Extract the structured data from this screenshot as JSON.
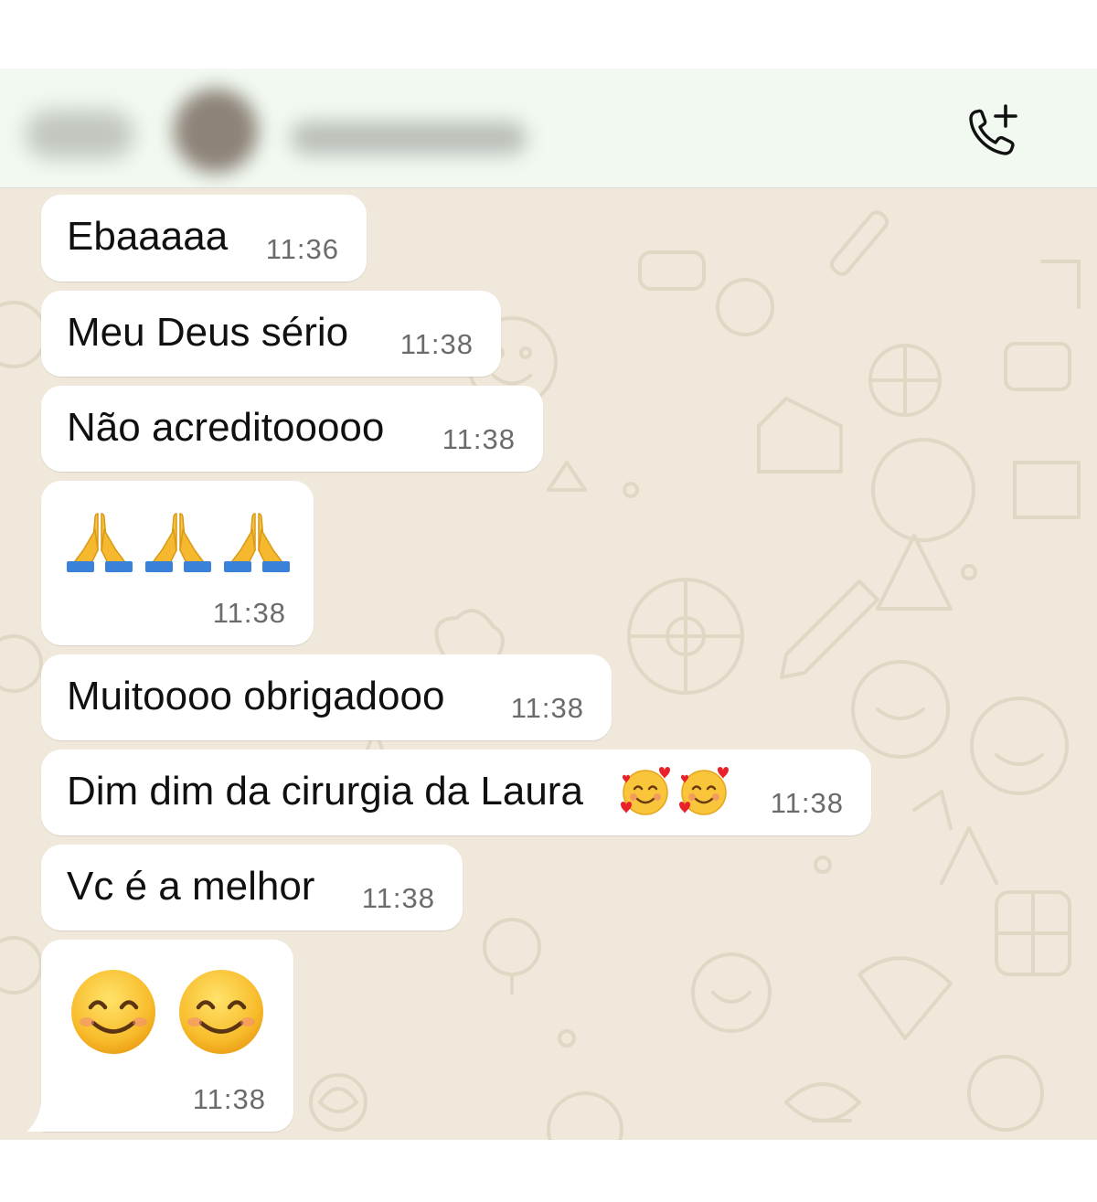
{
  "header": {
    "contact_name": "",
    "icons": {
      "call": "add-call-icon"
    }
  },
  "messages": [
    {
      "text": "Ebaaaaa",
      "time": "11:36"
    },
    {
      "text": "Meu Deus sério",
      "time": "11:38"
    },
    {
      "text": "Não acreditooooo",
      "time": "11:38"
    },
    {
      "text": "",
      "emoji": "folded-hands-icon",
      "count": 3,
      "time": "11:38"
    },
    {
      "text": "Muitoooo obrigadooo",
      "time": "11:38"
    },
    {
      "text": "Dim dim da cirurgia da Laura",
      "emoji": "smiling-face-with-hearts-icon",
      "count": 2,
      "time": "11:38"
    },
    {
      "text": "Vc é a melhor",
      "time": "11:38"
    },
    {
      "text": "",
      "emoji": "smiling-face-with-smiling-eyes-icon",
      "count": 2,
      "time": "11:38"
    }
  ],
  "colors": {
    "header_bg": "#f1f9f1",
    "chat_bg": "#efe8db",
    "bubble_bg": "#ffffff",
    "time_color": "#6b6b6b"
  }
}
